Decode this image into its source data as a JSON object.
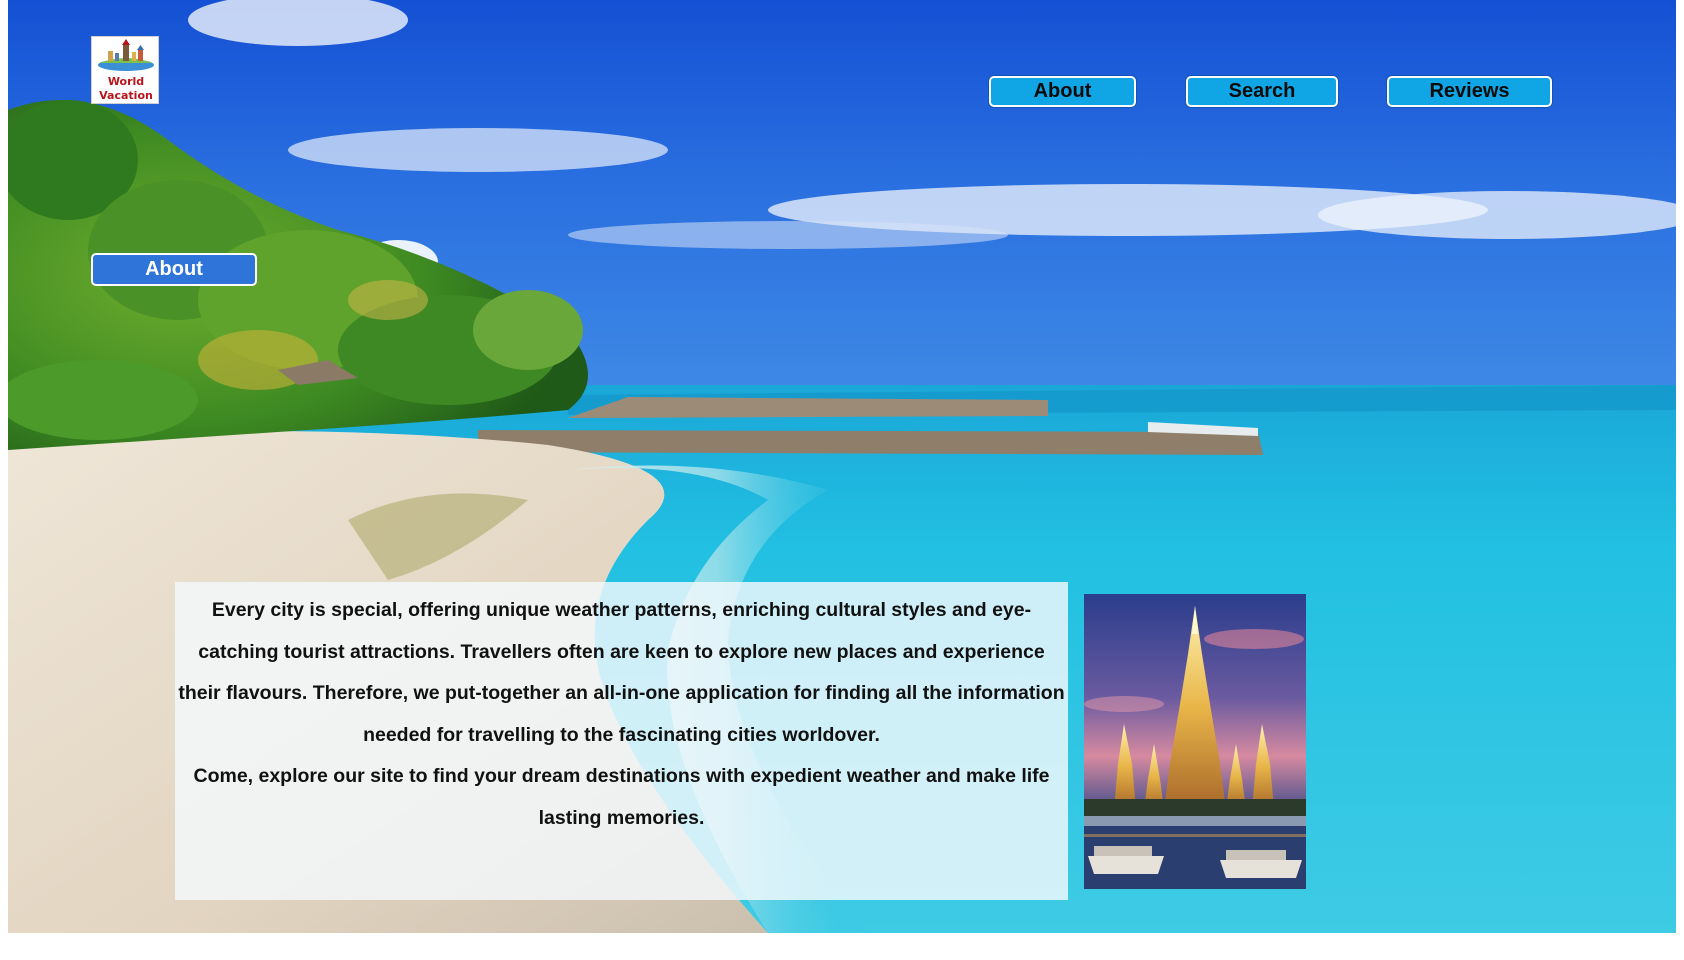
{
  "logo": {
    "line1": "World",
    "line2": "Vacation",
    "icon": "world-landmarks-icon"
  },
  "nav": {
    "about_label": "About",
    "search_label": "Search",
    "reviews_label": "Reviews"
  },
  "sidebar": {
    "about_label": "About"
  },
  "about": {
    "paragraph1": "Every city is special, offering unique weather patterns, enriching cultural styles and eye-catching tourist attractions. Travellers often are keen to explore new places and experience their flavours. Therefore, we put-together an all-in-one application for finding all the information needed for travelling to the fascinating cities worldover.",
    "paragraph2": "Come, explore our site to find your dream destinations with expedient weather and make life lasting memories."
  },
  "colors": {
    "nav_button": "#10a6e6",
    "side_button": "#2f74d9",
    "logo_text": "#b8141b",
    "sky": "#1f63d8",
    "sea": "#1fb8dc"
  }
}
